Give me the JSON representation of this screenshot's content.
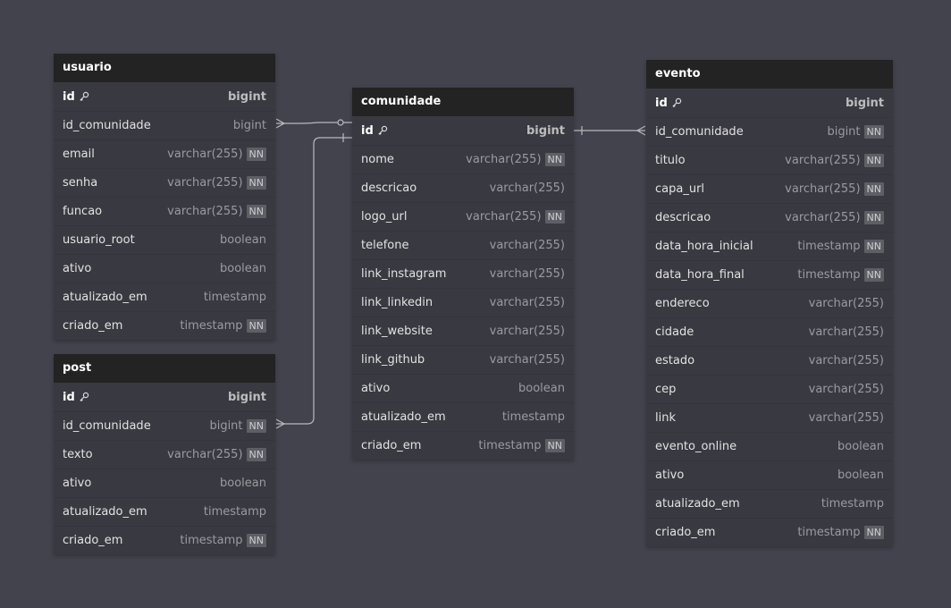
{
  "colors": {
    "background": "#43434d",
    "header": "#232323",
    "body": "#393941",
    "nn_badge": "#5e5e66"
  },
  "icons": {
    "primary_key": "key-icon"
  },
  "nn_label": "NN",
  "tables": [
    {
      "name": "usuario",
      "columns": [
        {
          "name": "id",
          "type": "bigint",
          "pk": true,
          "nn": false
        },
        {
          "name": "id_comunidade",
          "type": "bigint",
          "pk": false,
          "nn": false
        },
        {
          "name": "email",
          "type": "varchar(255)",
          "pk": false,
          "nn": true
        },
        {
          "name": "senha",
          "type": "varchar(255)",
          "pk": false,
          "nn": true
        },
        {
          "name": "funcao",
          "type": "varchar(255)",
          "pk": false,
          "nn": true
        },
        {
          "name": "usuario_root",
          "type": "boolean",
          "pk": false,
          "nn": false
        },
        {
          "name": "ativo",
          "type": "boolean",
          "pk": false,
          "nn": false
        },
        {
          "name": "atualizado_em",
          "type": "timestamp",
          "pk": false,
          "nn": false
        },
        {
          "name": "criado_em",
          "type": "timestamp",
          "pk": false,
          "nn": true
        }
      ]
    },
    {
      "name": "post",
      "columns": [
        {
          "name": "id",
          "type": "bigint",
          "pk": true,
          "nn": false
        },
        {
          "name": "id_comunidade",
          "type": "bigint",
          "pk": false,
          "nn": true
        },
        {
          "name": "texto",
          "type": "varchar(255)",
          "pk": false,
          "nn": true
        },
        {
          "name": "ativo",
          "type": "boolean",
          "pk": false,
          "nn": false
        },
        {
          "name": "atualizado_em",
          "type": "timestamp",
          "pk": false,
          "nn": false
        },
        {
          "name": "criado_em",
          "type": "timestamp",
          "pk": false,
          "nn": true
        }
      ]
    },
    {
      "name": "comunidade",
      "columns": [
        {
          "name": "id",
          "type": "bigint",
          "pk": true,
          "nn": false
        },
        {
          "name": "nome",
          "type": "varchar(255)",
          "pk": false,
          "nn": true
        },
        {
          "name": "descricao",
          "type": "varchar(255)",
          "pk": false,
          "nn": false
        },
        {
          "name": "logo_url",
          "type": "varchar(255)",
          "pk": false,
          "nn": true
        },
        {
          "name": "telefone",
          "type": "varchar(255)",
          "pk": false,
          "nn": false
        },
        {
          "name": "link_instagram",
          "type": "varchar(255)",
          "pk": false,
          "nn": false
        },
        {
          "name": "link_linkedin",
          "type": "varchar(255)",
          "pk": false,
          "nn": false
        },
        {
          "name": "link_website",
          "type": "varchar(255)",
          "pk": false,
          "nn": false
        },
        {
          "name": "link_github",
          "type": "varchar(255)",
          "pk": false,
          "nn": false
        },
        {
          "name": "ativo",
          "type": "boolean",
          "pk": false,
          "nn": false
        },
        {
          "name": "atualizado_em",
          "type": "timestamp",
          "pk": false,
          "nn": false
        },
        {
          "name": "criado_em",
          "type": "timestamp",
          "pk": false,
          "nn": true
        }
      ]
    },
    {
      "name": "evento",
      "columns": [
        {
          "name": "id",
          "type": "bigint",
          "pk": true,
          "nn": false
        },
        {
          "name": "id_comunidade",
          "type": "bigint",
          "pk": false,
          "nn": true
        },
        {
          "name": "titulo",
          "type": "varchar(255)",
          "pk": false,
          "nn": true
        },
        {
          "name": "capa_url",
          "type": "varchar(255)",
          "pk": false,
          "nn": true
        },
        {
          "name": "descricao",
          "type": "varchar(255)",
          "pk": false,
          "nn": true
        },
        {
          "name": "data_hora_inicial",
          "type": "timestamp",
          "pk": false,
          "nn": true
        },
        {
          "name": "data_hora_final",
          "type": "timestamp",
          "pk": false,
          "nn": true
        },
        {
          "name": "endereco",
          "type": "varchar(255)",
          "pk": false,
          "nn": false
        },
        {
          "name": "cidade",
          "type": "varchar(255)",
          "pk": false,
          "nn": false
        },
        {
          "name": "estado",
          "type": "varchar(255)",
          "pk": false,
          "nn": false
        },
        {
          "name": "cep",
          "type": "varchar(255)",
          "pk": false,
          "nn": false
        },
        {
          "name": "link",
          "type": "varchar(255)",
          "pk": false,
          "nn": false
        },
        {
          "name": "evento_online",
          "type": "boolean",
          "pk": false,
          "nn": false
        },
        {
          "name": "ativo",
          "type": "boolean",
          "pk": false,
          "nn": false
        },
        {
          "name": "atualizado_em",
          "type": "timestamp",
          "pk": false,
          "nn": false
        },
        {
          "name": "criado_em",
          "type": "timestamp",
          "pk": false,
          "nn": true
        }
      ]
    }
  ],
  "relations": [
    {
      "from": "usuario.id_comunidade",
      "to": "comunidade.id",
      "from_cardinality": "many",
      "to_cardinality": "zero-or-one"
    },
    {
      "from": "post.id_comunidade",
      "to": "comunidade.id",
      "from_cardinality": "many",
      "to_cardinality": "one"
    },
    {
      "from": "evento.id_comunidade",
      "to": "comunidade.id",
      "from_cardinality": "many",
      "to_cardinality": "one"
    }
  ]
}
